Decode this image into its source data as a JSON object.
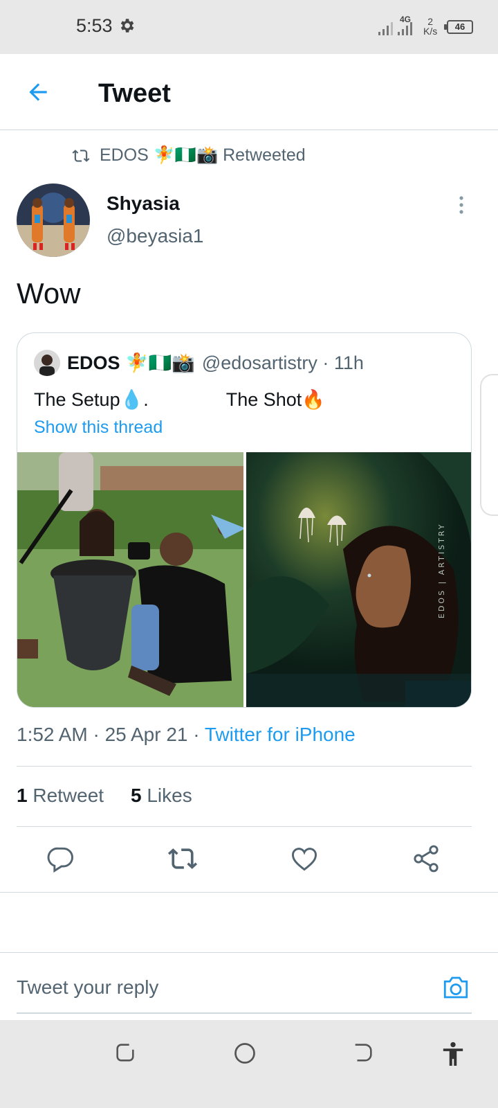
{
  "status_bar": {
    "time": "5:53",
    "network": "4G",
    "speed_value": "2",
    "speed_unit": "K/s",
    "battery": "46"
  },
  "header": {
    "title": "Tweet"
  },
  "retweet_context": {
    "text": "EDOS 🧚🇳🇬📸 Retweeted"
  },
  "tweet": {
    "display_name": "Shyasia",
    "handle": "@beyasia1",
    "text": "Wow",
    "timestamp": "1:52 AM · 25 Apr 21 · ",
    "source": "Twitter for iPhone",
    "retweet_count": "1",
    "retweet_label": " Retweet",
    "like_count": "5",
    "like_label": " Likes"
  },
  "quoted_tweet": {
    "display_name": "EDOS 🧚🇳🇬📸",
    "handle_time": "@edosartistry · 11h",
    "text": "The Setup💧.               The Shot🔥",
    "show_thread": "Show this thread",
    "watermark": "EDOS | ARTISTRY"
  },
  "reply": {
    "placeholder": "Tweet your reply"
  },
  "icons": {
    "back": "arrow-left-icon",
    "settings": "gear-icon",
    "retweet": "retweet-icon",
    "more": "more-vertical-icon",
    "reply": "reply-icon",
    "like": "heart-icon",
    "share": "share-icon",
    "camera": "camera-icon"
  },
  "colors": {
    "accent": "#1d9bf0",
    "text": "#0f1419",
    "muted": "#536471",
    "border": "#cfd9de"
  }
}
